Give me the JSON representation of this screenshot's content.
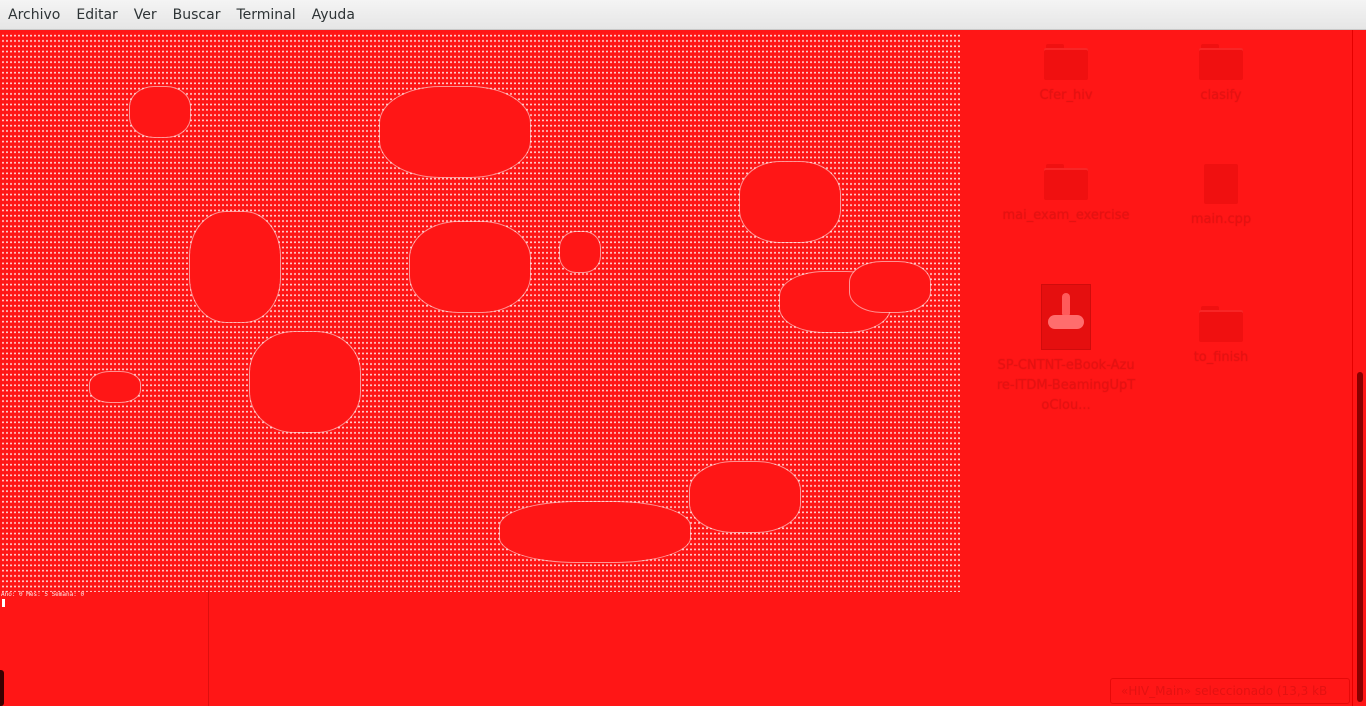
{
  "menu": {
    "items": [
      {
        "label": "Archivo"
      },
      {
        "label": "Editar"
      },
      {
        "label": "Ver"
      },
      {
        "label": "Buscar"
      },
      {
        "label": "Terminal"
      },
      {
        "label": "Ayuda"
      }
    ]
  },
  "terminal": {
    "status_line": "Año: 0 Mes: 5 Semana: 0",
    "background_color": "#ff1616",
    "dot_color": "#ffdcdc"
  },
  "desktop": {
    "icons": [
      {
        "label": "Cfer_hiv",
        "icon": "folder-icon"
      },
      {
        "label": "clasify",
        "icon": "folder-icon"
      },
      {
        "label": "mai_exam_exercise",
        "icon": "folder-icon"
      },
      {
        "label": "main.cpp",
        "icon": "file-icon"
      },
      {
        "label": "SP-CNTNT-eBook-Azure-ITDM-BeamingUpToClou...",
        "icon": "image-file-icon"
      },
      {
        "label": "to_finish",
        "icon": "folder-icon"
      }
    ],
    "selection_status": "«HIV_Main» seleccionado (13,3 kB"
  }
}
